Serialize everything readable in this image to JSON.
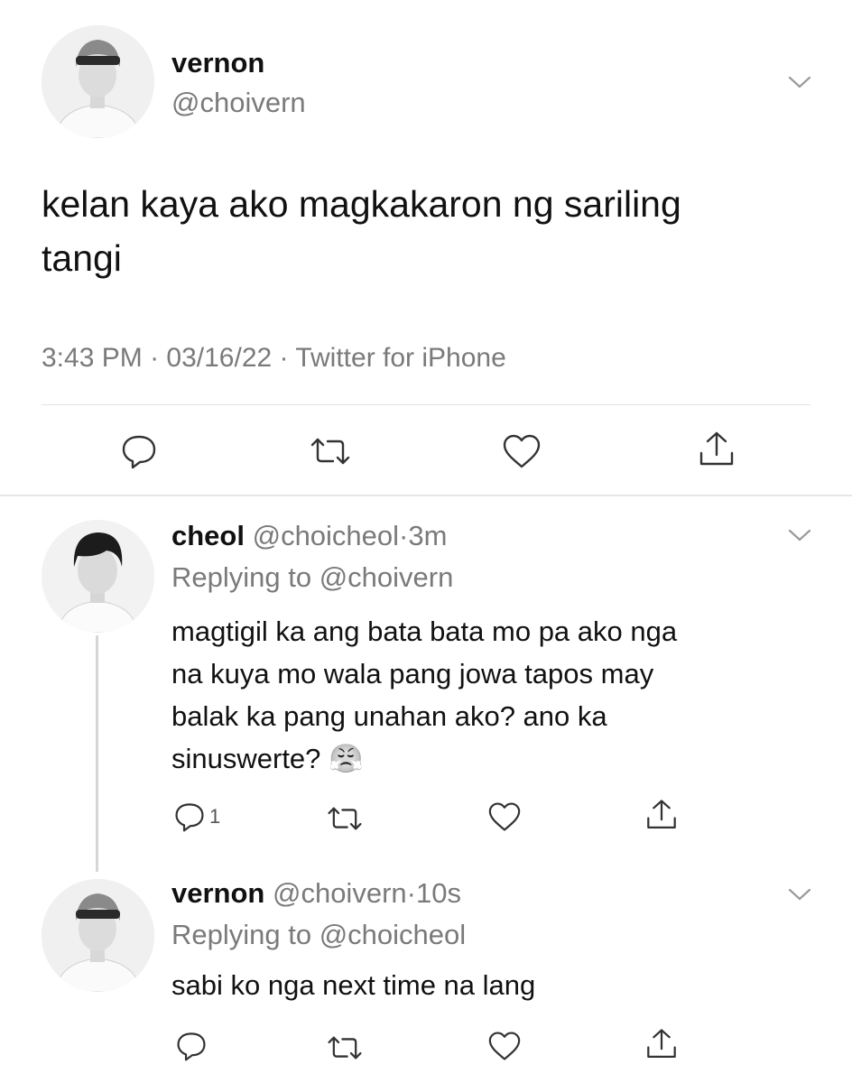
{
  "main_tweet": {
    "name": "vernon",
    "handle": "@choivern",
    "text_line1": "kelan kaya ako magkakaron ng sariling",
    "text_line2": "tangi",
    "time": "3:43 PM",
    "date": "03/16/22",
    "source": "Twitter for iPhone",
    "sep": "·"
  },
  "replies": [
    {
      "name": "cheol",
      "handle": "@choicheol",
      "time": "3m",
      "replying_to": "Replying to @choivern",
      "text_lines": [
        "magtigil ka ang bata bata mo pa ako nga",
        "na kuya mo wala pang jowa tapos may",
        "balak ka pang unahan ako? ano ka",
        "sinuswerte?"
      ],
      "emoji": "😤",
      "reply_count": "1"
    },
    {
      "name": "vernon",
      "handle": "@choivern",
      "time": "10s",
      "replying_to": "Replying to @choicheol",
      "text_lines": [
        "sabi ko nga next time na lang"
      ]
    }
  ],
  "icons": [
    "reply-icon",
    "retweet-icon",
    "like-icon",
    "share-icon",
    "chevron-down-icon"
  ],
  "colors": {
    "text": "#111111",
    "muted": "#7a7a7a",
    "divider": "#e3e3e3"
  }
}
